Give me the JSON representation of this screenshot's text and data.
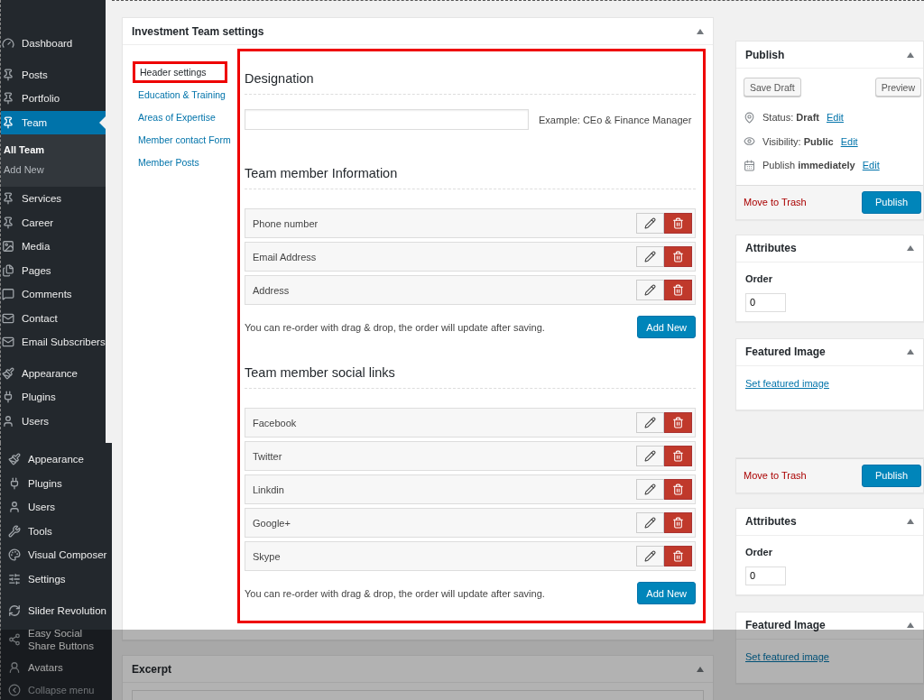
{
  "sidebar": {
    "groups": [
      [
        {
          "label": "Dashboard",
          "selected": false
        }
      ],
      [
        {
          "label": "Posts",
          "selected": false
        },
        {
          "label": "Portfolio",
          "selected": false
        },
        {
          "label": "Team",
          "selected": true,
          "children": [
            {
              "label": "All Team",
              "selected": true
            },
            {
              "label": "Add New",
              "selected": false
            }
          ]
        },
        {
          "label": "Services",
          "selected": false
        },
        {
          "label": "Career",
          "selected": false
        },
        {
          "label": "Media",
          "selected": false
        },
        {
          "label": "Pages",
          "selected": false
        },
        {
          "label": "Comments",
          "selected": false
        },
        {
          "label": "Contact",
          "selected": false
        },
        {
          "label": "Email Subscribers",
          "selected": false
        }
      ],
      [
        {
          "label": "Appearance",
          "selected": false
        },
        {
          "label": "Plugins",
          "selected": false
        },
        {
          "label": "Users",
          "selected": false
        }
      ]
    ]
  },
  "sidebar_2": {
    "groups": [
      [
        {
          "label": "Appearance",
          "selected": false
        },
        {
          "label": "Plugins",
          "selected": false
        },
        {
          "label": "Users",
          "selected": false
        },
        {
          "label": "Tools",
          "selected": false
        },
        {
          "label": "Visual Composer",
          "selected": false
        },
        {
          "label": "Settings",
          "selected": false
        }
      ],
      [
        {
          "label": "Slider Revolution",
          "selected": false
        },
        {
          "label": "Easy Social Share Buttons",
          "selected": false
        },
        {
          "label": "Avatars",
          "selected": false
        }
      ]
    ],
    "collapse": "Collapse menu"
  },
  "settings_box": {
    "title": "Investment Team settings",
    "tabs": [
      {
        "label": "Header settings",
        "selected": true
      },
      {
        "label": "Education & Training",
        "selected": false
      },
      {
        "label": "Areas of Expertise",
        "selected": false
      },
      {
        "label": "Member contact Form",
        "selected": false
      },
      {
        "label": "Member Posts",
        "selected": false
      }
    ],
    "designation": {
      "heading": "Designation",
      "hint": "Example: CEo & Finance Manager"
    },
    "sections": [
      {
        "heading": "Team member Information",
        "rows": [
          "Phone number",
          "Email Address",
          "Address"
        ],
        "note": "You can re-order with drag & drop, the order will update after saving.",
        "button": "Add New"
      },
      {
        "heading": "Team member social links",
        "rows": [
          "Facebook",
          "Twitter",
          "Linkdin",
          "Google+",
          "Skype"
        ],
        "note": "You can re-order with drag & drop, the order will update after saving.",
        "button": "Add New"
      }
    ]
  },
  "excerpt_box": {
    "title": "Excerpt"
  },
  "publish": {
    "title": "Publish",
    "save_draft": "Save Draft",
    "preview": "Preview",
    "lines": [
      {
        "text": "Status: **Draft**",
        "link": "Edit"
      },
      {
        "text": "Visibility: **Public**",
        "link": "Edit"
      },
      {
        "text": "Publish **immediately**",
        "link": "Edit"
      }
    ],
    "trash": "Move to Trash",
    "button": "Publish"
  },
  "attributes": {
    "title": "Attributes",
    "label": "Order",
    "value": "0"
  },
  "featured_image": {
    "title": "Featured Image",
    "link": "Set featured image"
  },
  "publish_footer_2": {
    "trash": "Move to Trash",
    "button": "Publish"
  },
  "attributes_2": {
    "title": "Attributes",
    "label": "Order",
    "value": "0"
  },
  "featured_image_2": {
    "title": "Featured Image",
    "link": "Set featured image"
  }
}
